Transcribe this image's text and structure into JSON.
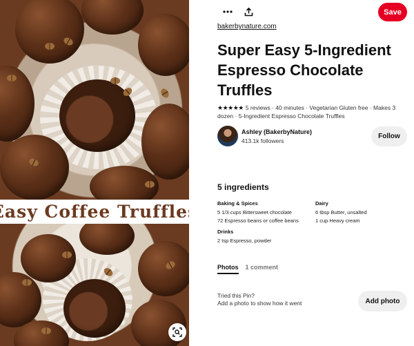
{
  "image": {
    "banner_text": "Easy Coffee Truffles",
    "lens_icon": "visual-search-icon"
  },
  "toolbar": {
    "more_icon": "more-options-icon",
    "share_icon": "share-icon",
    "save_label": "Save",
    "save_color": "#e60023"
  },
  "pin": {
    "source": "bakerbynature.com",
    "title": "Super Easy 5-Ingredient Espresso Chocolate Truffles",
    "rating_stars": 5,
    "stars_glyphs": "★★★★★",
    "reviews": "5 reviews",
    "meta_rest": " · 40 minutes · Vegetarian Gluten free · Makes 3 dozen · 5-Ingredient Espresso Chocolate Truffles"
  },
  "author": {
    "name": "Ashley (BakerbyNature)",
    "followers": "413.1k followers",
    "follow_label": "Follow"
  },
  "ingredients": {
    "heading": "5 ingredients",
    "groups_left": [
      {
        "title": "Baking & Spices",
        "items": [
          "5 1/3 cups Bittersweet chocolate",
          "72 Espresso beans or coffee beans"
        ]
      },
      {
        "title": "Drinks",
        "items": [
          "2 tsp Espresso, powder"
        ]
      }
    ],
    "groups_right": [
      {
        "title": "Dairy",
        "items": [
          "6 tbsp Butter, unsalted",
          "1 cup Heavy cream"
        ]
      }
    ]
  },
  "tabs": {
    "photos": "Photos",
    "comments": "1 comment"
  },
  "tried": {
    "title": "Tried this Pin?",
    "subtitle": "Add a photo to show how it went",
    "button": "Add photo"
  }
}
